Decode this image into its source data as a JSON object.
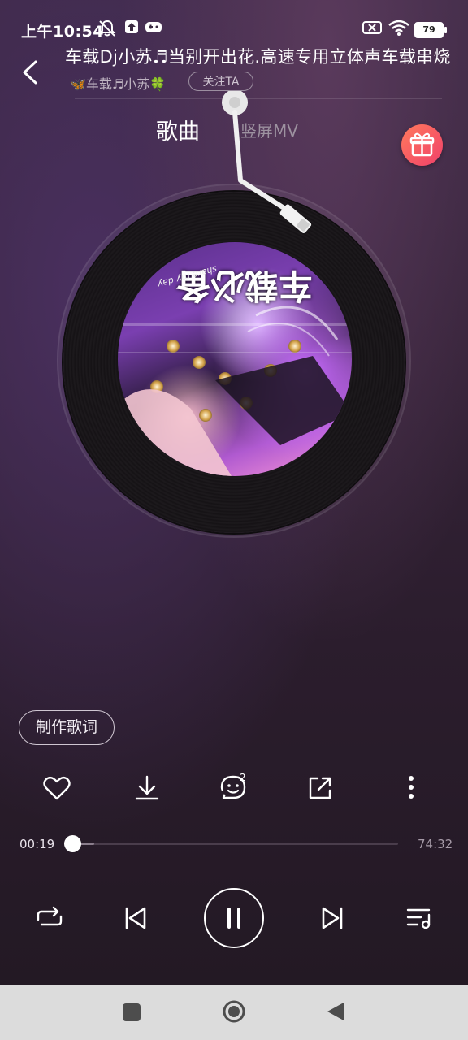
{
  "status_bar": {
    "time": "上午10:54",
    "battery": "79"
  },
  "header": {
    "title": "车载Dj小苏♬当别开出花.高速专用立体声车载串烧",
    "artist": "🦋车载♬小苏🍀",
    "follow_label": "关注TA"
  },
  "tabs": {
    "song": "歌曲",
    "mv": "竖屏MV"
  },
  "cover": {
    "text": "车载必备",
    "subtext": "share my day"
  },
  "lyrics_button": "制作歌词",
  "actions": {
    "comment_count": "2"
  },
  "progress": {
    "current": "00:19",
    "total": "74:32",
    "fraction": 0.0043
  },
  "icons": [
    "back-icon",
    "heart-icon",
    "download-icon",
    "comment-icon",
    "share-icon",
    "more-icon",
    "repeat-icon",
    "previous-icon",
    "pause-icon",
    "next-icon",
    "playlist-icon",
    "gift-icon"
  ],
  "colors": {
    "gift_gradient_start": "#ff7a5c",
    "gift_gradient_end": "#f0406a",
    "navbar": "#dcdcdc"
  }
}
